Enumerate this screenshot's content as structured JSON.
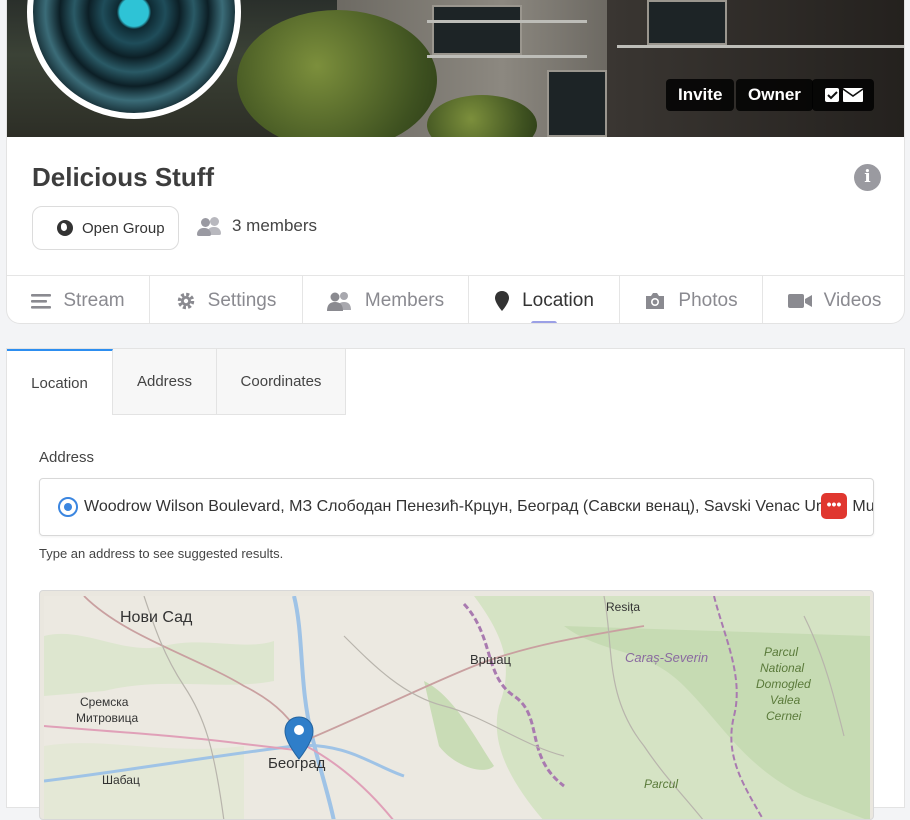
{
  "cover": {
    "actions": [
      {
        "label": "Invite"
      },
      {
        "label": "Owner"
      }
    ],
    "icons": [
      "check-square-icon",
      "envelope-icon"
    ]
  },
  "group": {
    "title": "Delicious Stuff",
    "type_label": "Open Group",
    "members_label": "3 members"
  },
  "tabs": [
    {
      "label": "Stream",
      "icon": "bars-icon"
    },
    {
      "label": "Settings",
      "icon": "gear-icon"
    },
    {
      "label": "Members",
      "icon": "users-icon"
    },
    {
      "label": "Location",
      "icon": "map-pin-icon",
      "active": true
    },
    {
      "label": "Photos",
      "icon": "camera-icon"
    },
    {
      "label": "Videos",
      "icon": "video-icon"
    }
  ],
  "location": {
    "subtabs": [
      "Location",
      "Address",
      "Coordinates"
    ],
    "address_label": "Address",
    "address_value": "Woodrow Wilson Boulevard, МЗ Слободан Пенезић-Крцун, Београд (Савски венац), Savski Venac Urban Muni",
    "help_text": "Type an address to see suggested results.",
    "map_labels": [
      "Нови Сад",
      "Resița",
      "Вршац",
      "Caraș-Severin",
      "Parcul",
      "National",
      "Domogled",
      "Valea",
      "Cernei",
      "Сремска",
      "Митровица",
      "Београд",
      "Шабац",
      "Parcul"
    ]
  },
  "colors": {
    "accent": "#2d8ef0",
    "tab_indicator": "#9ba0e6",
    "danger": "#e0372f",
    "map_pin": "#2f7ec9"
  }
}
